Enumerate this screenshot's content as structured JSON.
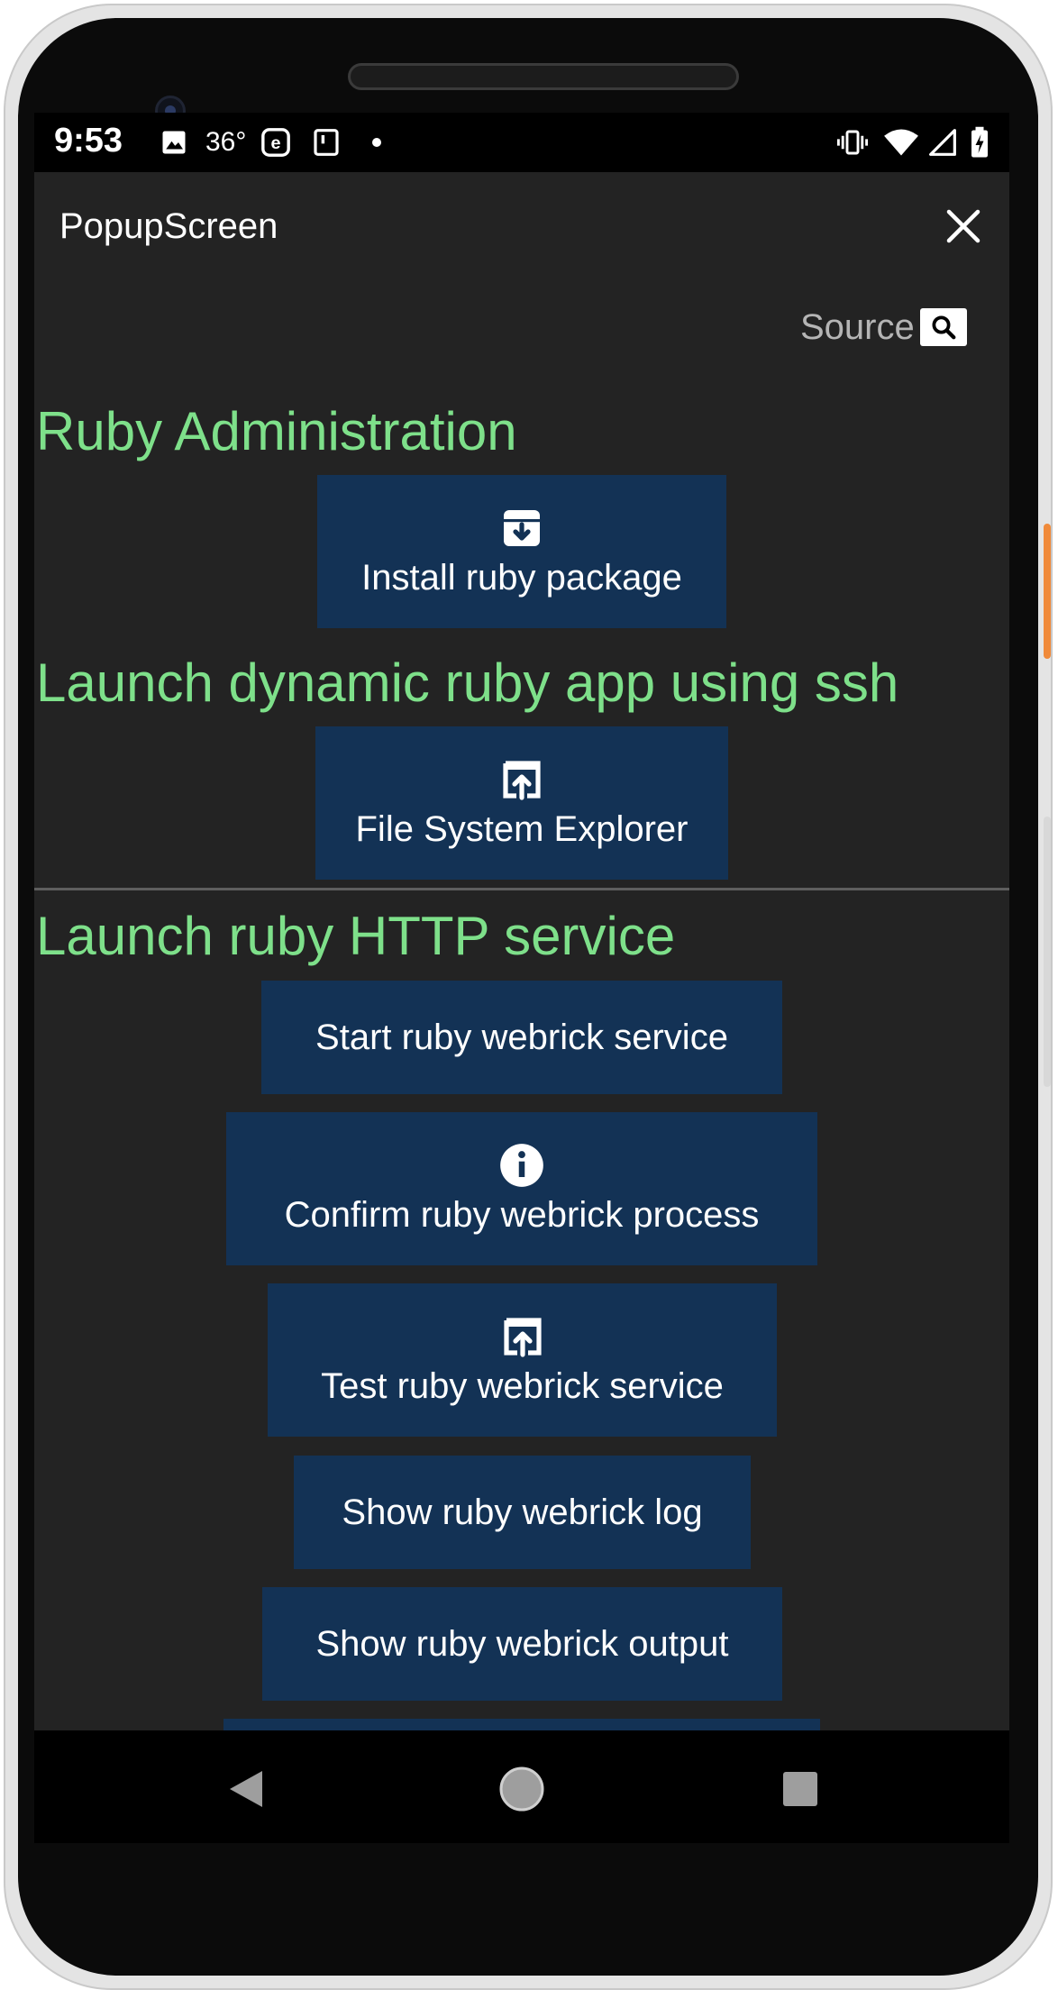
{
  "status_bar": {
    "time": "9:53",
    "temperature": "36°",
    "left_icons": [
      "image-icon",
      "edge-browser-icon",
      "sim-card-icon",
      "dot-icon"
    ],
    "right_icons": [
      "vibrate-icon",
      "wifi-icon",
      "signal-icon",
      "battery-charging-icon"
    ]
  },
  "app_bar": {
    "title": "PopupScreen",
    "close_icon": "close-icon"
  },
  "source_link": {
    "label": "Source",
    "icon": "search-icon"
  },
  "sections": [
    {
      "heading": "Ruby Administration",
      "actions": [
        {
          "label": "Install ruby package",
          "icon": "archive-download-icon"
        }
      ]
    },
    {
      "heading": "Launch dynamic ruby app using ssh",
      "actions": [
        {
          "label": "File System Explorer",
          "icon": "open-in-new-icon"
        }
      ]
    },
    {
      "heading": "Launch ruby HTTP service",
      "actions": [
        {
          "label": "Start ruby webrick service",
          "icon": ""
        },
        {
          "label": "Confirm ruby webrick process",
          "icon": "info-icon"
        },
        {
          "label": "Test ruby webrick service",
          "icon": "open-in-new-icon"
        },
        {
          "label": "Show ruby webrick log",
          "icon": ""
        },
        {
          "label": "Show ruby webrick output",
          "icon": ""
        }
      ]
    }
  ],
  "colors": {
    "screen_background": "#232323",
    "heading_green": "#7ee08a",
    "button_navy": "#133255",
    "status_bar": "#000000"
  },
  "nav_bar": {
    "back_icon": "back-triangle-icon",
    "home_icon": "home-circle-icon",
    "recents_icon": "recents-square-icon"
  }
}
